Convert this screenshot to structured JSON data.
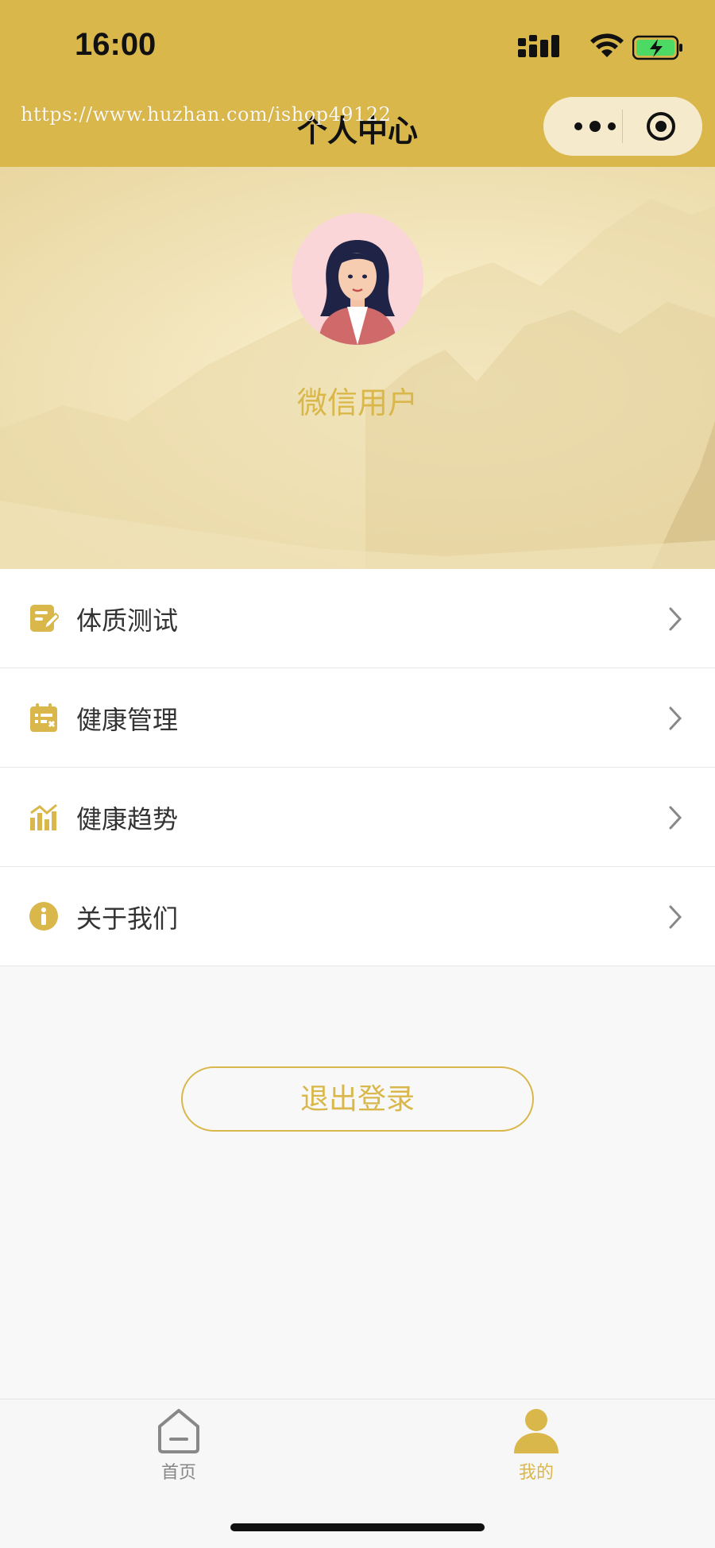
{
  "status_bar": {
    "time": "16:00"
  },
  "header": {
    "watermark_url": "https://www.huzhan.com/ishop49122",
    "title": "个人中心"
  },
  "profile": {
    "username": "微信用户"
  },
  "menu": {
    "items": [
      {
        "label": "体质测试",
        "icon": "edit-document-icon"
      },
      {
        "label": "健康管理",
        "icon": "clipboard-icon"
      },
      {
        "label": "健康趋势",
        "icon": "bar-trend-icon"
      },
      {
        "label": "关于我们",
        "icon": "info-icon"
      }
    ]
  },
  "logout": {
    "label": "退出登录"
  },
  "tabbar": {
    "tabs": [
      {
        "label": "首页",
        "icon": "home-icon",
        "active": false
      },
      {
        "label": "我的",
        "icon": "user-icon",
        "active": true
      }
    ]
  },
  "colors": {
    "accent": "#d9b74a",
    "text": "#333333",
    "muted": "#888888"
  }
}
